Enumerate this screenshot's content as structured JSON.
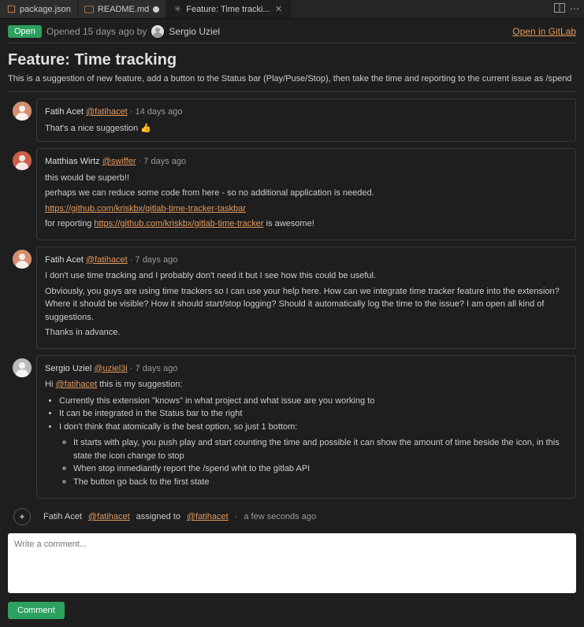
{
  "tabs": [
    {
      "label": "package.json",
      "icon": "json"
    },
    {
      "label": "README.md",
      "icon": "md",
      "dirty": true
    },
    {
      "label": "Feature: Time tracki...",
      "icon": "gitlab",
      "active": true,
      "closable": true
    }
  ],
  "header": {
    "status": "Open",
    "opened_text": "Opened 15 days ago by",
    "author": "Sergio Uziel",
    "open_link": "Open in GitLab"
  },
  "page": {
    "title": "Feature: Time tracking",
    "description": "This is a suggestion of new feature, add a button to the Status bar (Play/Puse/Stop), then take the time and reporting to the current issue as /spend"
  },
  "comments": [
    {
      "author": "Fatih Acet",
      "handle": "@fatihacet",
      "time": "14 days ago",
      "body_html": "That's a nice suggestion 👍"
    },
    {
      "author": "Matthias Wirtz",
      "handle": "@swiffer",
      "time": "7 days ago",
      "body_html": "<p>this would be superb!!</p><p>perhaps we can reduce some code from here - so no additional application is needed.</p><p><a class='link-orange'>https://github.com/kriskbx/gitlab-time-tracker-taskbar</a></p><p>for reporting <a class='link-orange'>https://github.com/kriskbx/gitlab-time-tracker</a> is awesome!</p>"
    },
    {
      "author": "Fatih Acet",
      "handle": "@fatihacet",
      "time": "7 days ago",
      "body_html": "<p>I don't use time tracking and I probably don't need it but I see how this could be useful.</p><p>Obviously, you guys are using time trackers so I can use your help here. How can we integrate time tracker feature into the extension? Where it should be visible? How it should start/stop logging? Should it automatically log the time to the issue? I am open all kind of suggestions.</p><p>Thanks in advance.</p>"
    },
    {
      "author": "Sergio Uziel",
      "handle": "@uziel3i",
      "time": "7 days ago",
      "body_html": "<p>Hi <a class='usertag'>@fatihacet</a> this is my suggestion:</p><ul><li>Currently this extension \"knows\" in what project and what issue are you working to</li><li>It can be integrated in the Status bar to the right</li><li>I don't think that atomically is the best option, so just 1 bottom:<ul><li>It starts with play, you push play and start counting the time and possible it can show the amount of time beside the icon, in this state the icon change to stop</li><li>When stop inmediantly report the /spend whit to the gitlab API</li><li>The button go back to the first state</li></ul></li></ul>"
    }
  ],
  "system_event": {
    "author": "Fatih Acet",
    "handle": "@fatihacet",
    "action": "assigned to",
    "target": "@fatihacet",
    "time": "a few seconds ago"
  },
  "composer": {
    "placeholder": "Write a comment...",
    "button": "Comment"
  }
}
